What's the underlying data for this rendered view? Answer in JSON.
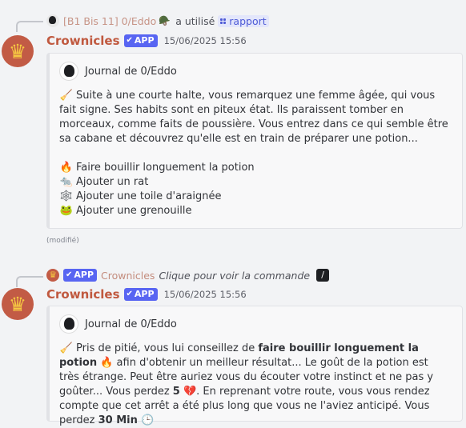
{
  "message1": {
    "reply": {
      "user": "[B1 Bis 11] 0/Eddo",
      "user_emoji": "🪖",
      "action": "a utilisé",
      "command": "rapport"
    },
    "author": "Crownicles",
    "badge": "APP",
    "timestamp": "15/06/2025 15:56",
    "embed": {
      "author": "Journal de 0/Eddo",
      "description_emoji": "🧹",
      "description": "Suite à une courte halte, vous remarquez une femme âgée, qui vous fait signe. Ses habits sont en piteux état. Ils paraissent tomber en morceaux, comme faits de poussière. Vous entrez dans ce qui semble être sa cabane et découvrez qu'elle est en train de préparer une potion...",
      "choices": [
        {
          "emoji": "🔥",
          "label": "Faire bouillir longuement la potion"
        },
        {
          "emoji": "🐀",
          "label": "Ajouter un rat"
        },
        {
          "emoji": "🕸️",
          "label": "Ajouter une toile d'araignée"
        },
        {
          "emoji": "🐸",
          "label": "Ajouter une grenouille"
        }
      ]
    },
    "edited": "(modifié)"
  },
  "message2": {
    "reply": {
      "badge": "APP",
      "app_name": "Crownicles",
      "hint": "Clique pour voir la commande"
    },
    "author": "Crownicles",
    "badge": "APP",
    "timestamp": "15/06/2025 15:56",
    "embed": {
      "author": "Journal de 0/Eddo",
      "emoji_intro": "🧹",
      "text_1": "Pris de pitié, vous lui conseillez de ",
      "bold_choice": "faire bouillir longuement la potion",
      "emoji_choice": "🔥",
      "text_2": " afin d'obtenir un meilleur résultat... Le goût de la potion est très étrange. Peut être auriez vous du écouter votre instinct et ne pas y goûter... Vous perdez ",
      "health_lost": "5",
      "emoji_health": "💔",
      "text_3": ". En reprenant votre route, vous vous rendez compte que cet arrêt a été plus long que vous ne l'aviez anticipé. Vous perdez ",
      "time_lost": "30 Min",
      "emoji_time": "🕒"
    }
  },
  "colors": {
    "author": "#c0593f",
    "badge": "#5865f2",
    "mention_bg": "#e3e6fb",
    "mention_text": "#4e5bd6",
    "avatar_bg": "#c25b45"
  },
  "icons": {
    "avatar": "crown-icon",
    "verified": "check-icon",
    "command": "slash-command-icon",
    "mention_grid": "app-grid-icon"
  }
}
